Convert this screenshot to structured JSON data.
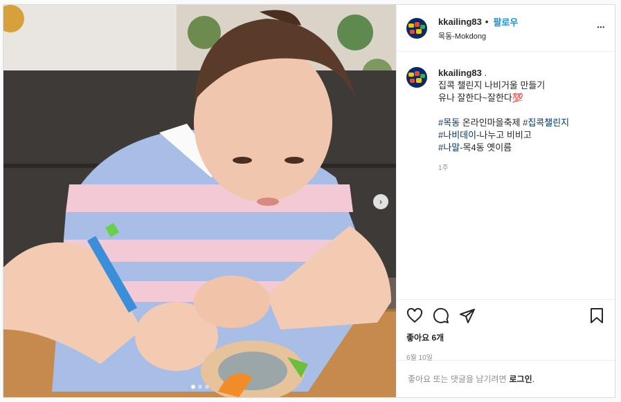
{
  "post": {
    "username": "kkailing83",
    "follow_label": "팔로우",
    "separator": "•",
    "location": "목동-Mokdong",
    "more_label": "•••"
  },
  "caption": {
    "username": "kkailing83",
    "trailing": ".",
    "line1": "집콕 챌린지 나비거울 만들기",
    "line2": "유나 잘한다~잘한다💯",
    "tag1": "#목동",
    "tag1_text": " 온라인마을축제 ",
    "tag2": "#집콕챌린지",
    "tag3": "#나비데이",
    "tag3_text": "-나누고 비비고",
    "tag4": "#나말",
    "tag4_text": "-목4동 옛이름",
    "time": "1주"
  },
  "actions": {
    "likes": "좋아요 6개",
    "date": "6월 10일"
  },
  "login": {
    "prefix": "좋아요 또는 댓글을 남기려면",
    "link": "로그인",
    "suffix": "."
  },
  "carousel": {
    "next_label": "›",
    "count": 3,
    "active_index": 0
  },
  "colors": {
    "accent": "#0095f6",
    "hashtag": "#00376b",
    "muted": "#8e8e8e"
  },
  "icons": [
    "heart-icon",
    "comment-icon",
    "share-icon",
    "bookmark-icon",
    "more-icon",
    "chevron-right-icon"
  ]
}
